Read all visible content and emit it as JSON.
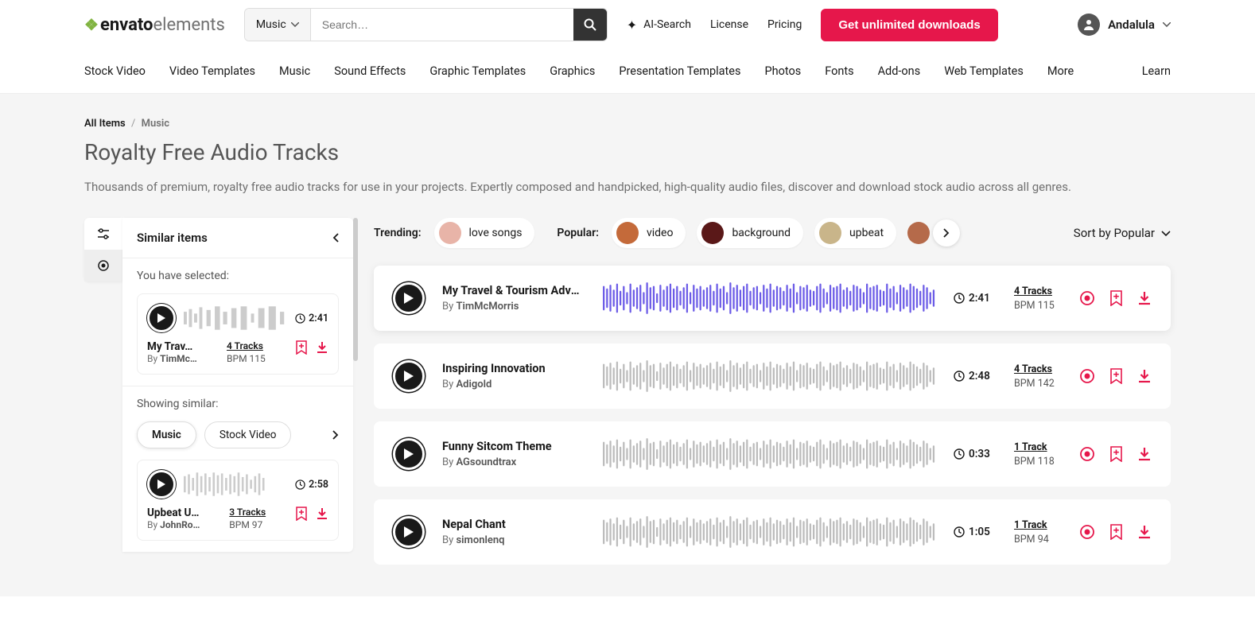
{
  "header": {
    "logo_bold": "envato",
    "logo_thin": "elements",
    "search_category": "Music",
    "search_placeholder": "Search…",
    "ai_search": "AI-Search",
    "license": "License",
    "pricing": "Pricing",
    "cta": "Get unlimited downloads",
    "username": "Andalula"
  },
  "nav": {
    "items": [
      "Stock Video",
      "Video Templates",
      "Music",
      "Sound Effects",
      "Graphic Templates",
      "Graphics",
      "Presentation Templates",
      "Photos",
      "Fonts",
      "Add-ons",
      "Web Templates",
      "More"
    ],
    "learn": "Learn"
  },
  "crumbs": {
    "root": "All Items",
    "current": "Music"
  },
  "page": {
    "title": "Royalty Free Audio Tracks",
    "desc": "Thousands of premium, royalty free audio tracks for use in your projects. Expertly composed and handpicked, high-quality audio files, discover and download stock audio across all genres."
  },
  "sidebar": {
    "title": "Similar items",
    "selected_label": "You have selected:",
    "showing_label": "Showing similar:",
    "chips": [
      "Music",
      "Stock Video"
    ],
    "selected": {
      "title": "My Trav…",
      "by_prefix": "By ",
      "author": "TimMc…",
      "duration": "2:41",
      "tracks": "4 Tracks",
      "bpm": "BPM 115"
    },
    "similar": [
      {
        "title": "Upbeat U…",
        "by_prefix": "By ",
        "author": "JohnRo…",
        "duration": "2:58",
        "tracks": "3 Tracks",
        "bpm": "BPM 97"
      }
    ]
  },
  "filters": {
    "trending_label": "Trending:",
    "popular_label": "Popular:",
    "trending": [
      {
        "label": "love songs",
        "color": "#e8b4a8"
      }
    ],
    "popular": [
      {
        "label": "video",
        "color": "#c46a3a"
      },
      {
        "label": "background",
        "color": "#5a1818"
      },
      {
        "label": "upbeat",
        "color": "#c9b58a"
      }
    ],
    "extra_color": "#b56a4a",
    "sort": "Sort by Popular"
  },
  "tracks": [
    {
      "title": "My Travel & Tourism Adven…",
      "by_prefix": "By ",
      "author": "TimMcMorris",
      "duration": "2:41",
      "tracks": "4 Tracks",
      "bpm": "BPM 115",
      "active": true
    },
    {
      "title": "Inspiring Innovation",
      "by_prefix": "By ",
      "author": "Adigold",
      "duration": "2:48",
      "tracks": "4 Tracks",
      "bpm": "BPM 142",
      "active": false
    },
    {
      "title": "Funny Sitcom Theme",
      "by_prefix": "By ",
      "author": "AGsoundtrax",
      "duration": "0:33",
      "tracks": "1 Track",
      "bpm": "BPM 118",
      "active": false
    },
    {
      "title": "Nepal Chant",
      "by_prefix": "By ",
      "author": "simonlenq",
      "duration": "1:05",
      "tracks": "1 Track",
      "bpm": "BPM 94",
      "active": false
    }
  ]
}
